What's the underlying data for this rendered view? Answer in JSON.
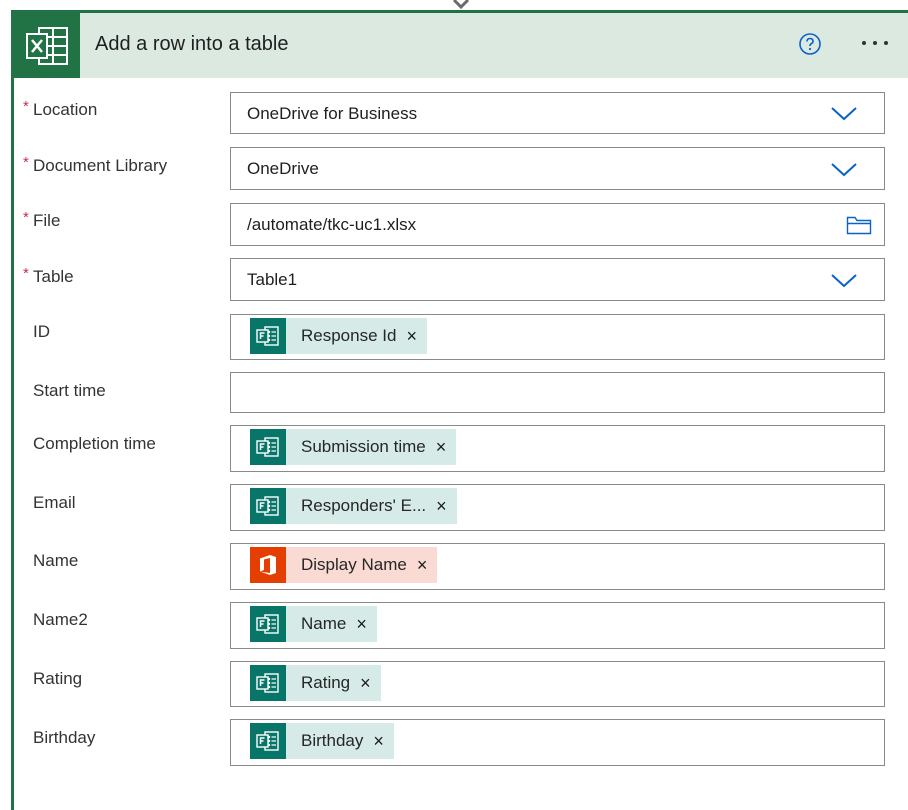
{
  "header": {
    "title": "Add a row into a table",
    "icon": "excel-icon",
    "help_icon": "help-icon",
    "more_icon": "more-options-icon",
    "accent_color": "#217346",
    "header_bg": "#dbe9e1"
  },
  "fields": {
    "location": {
      "label": "Location",
      "required": "*",
      "value": "OneDrive for Business",
      "control": "dropdown"
    },
    "library": {
      "label": "Document Library",
      "required": "*",
      "value": "OneDrive",
      "control": "dropdown"
    },
    "file": {
      "label": "File",
      "required": "*",
      "value": "/automate/tkc-uc1.xlsx",
      "control": "file-picker"
    },
    "table": {
      "label": "Table",
      "required": "*",
      "value": "Table1",
      "control": "dropdown"
    },
    "id": {
      "label": "ID",
      "token": "Response Id",
      "token_source": "forms"
    },
    "start_time": {
      "label": "Start time",
      "value": ""
    },
    "completion_time": {
      "label": "Completion time",
      "token": "Submission time",
      "token_source": "forms"
    },
    "email": {
      "label": "Email",
      "token": "Responders' E...",
      "token_source": "forms"
    },
    "name": {
      "label": "Name",
      "token": "Display Name",
      "token_source": "office365"
    },
    "name2": {
      "label": "Name2",
      "token": "Name",
      "token_source": "forms"
    },
    "rating": {
      "label": "Rating",
      "token": "Rating",
      "token_source": "forms"
    },
    "birthday": {
      "label": "Birthday",
      "token": "Birthday",
      "token_source": "forms"
    }
  },
  "token_remove_glyph": "×",
  "colors": {
    "forms_token_bg": "#d6ebe8",
    "forms_icon_bg": "#077568",
    "office_token_bg": "#fadbd4",
    "office_icon_bg": "#e43e00",
    "required_star": "#c4314b",
    "chevron": "#0a62c9"
  }
}
